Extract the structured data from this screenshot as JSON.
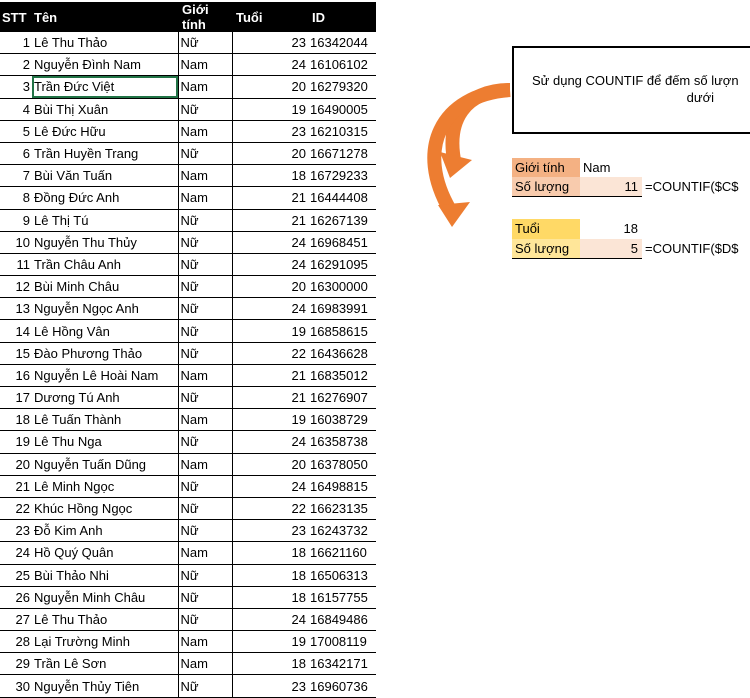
{
  "headers": {
    "stt": "STT",
    "ten": "Tên",
    "gioitinh": "Giới tính",
    "tuoi": "Tuổi",
    "id": "ID"
  },
  "rows": [
    {
      "stt": "1",
      "ten": "Lê Thu Thảo",
      "gt": "Nữ",
      "tuoi": "23",
      "id": "16342044"
    },
    {
      "stt": "2",
      "ten": "Nguyễn Đình Nam",
      "gt": "Nam",
      "tuoi": "24",
      "id": "16106102"
    },
    {
      "stt": "3",
      "ten": "Trần Đức Việt",
      "gt": "Nam",
      "tuoi": "20",
      "id": "16279320"
    },
    {
      "stt": "4",
      "ten": "Bùi Thị Xuân",
      "gt": "Nữ",
      "tuoi": "19",
      "id": "16490005"
    },
    {
      "stt": "5",
      "ten": "Lê Đức Hữu",
      "gt": "Nam",
      "tuoi": "23",
      "id": "16210315"
    },
    {
      "stt": "6",
      "ten": "Trần Huyền Trang",
      "gt": "Nữ",
      "tuoi": "20",
      "id": "16671278"
    },
    {
      "stt": "7",
      "ten": "Bùi Văn Tuấn",
      "gt": "Nam",
      "tuoi": "18",
      "id": "16729233"
    },
    {
      "stt": "8",
      "ten": "Đồng Đức Anh",
      "gt": "Nam",
      "tuoi": "21",
      "id": "16444408"
    },
    {
      "stt": "9",
      "ten": "Lê Thị Tú",
      "gt": "Nữ",
      "tuoi": "21",
      "id": "16267139"
    },
    {
      "stt": "10",
      "ten": "Nguyễn Thu Thủy",
      "gt": "Nữ",
      "tuoi": "24",
      "id": "16968451"
    },
    {
      "stt": "11",
      "ten": "Trần Châu Anh",
      "gt": "Nữ",
      "tuoi": "24",
      "id": "16291095"
    },
    {
      "stt": "12",
      "ten": "Bùi Minh Châu",
      "gt": "Nữ",
      "tuoi": "20",
      "id": "16300000"
    },
    {
      "stt": "13",
      "ten": "Nguyễn Ngọc Anh",
      "gt": "Nữ",
      "tuoi": "24",
      "id": "16983991"
    },
    {
      "stt": "14",
      "ten": "Lê Hồng Vân",
      "gt": "Nữ",
      "tuoi": "19",
      "id": "16858615"
    },
    {
      "stt": "15",
      "ten": "Đào Phương Thảo",
      "gt": "Nữ",
      "tuoi": "22",
      "id": "16436628"
    },
    {
      "stt": "16",
      "ten": "Nguyễn Lê Hoài Nam",
      "gt": "Nam",
      "tuoi": "21",
      "id": "16835012"
    },
    {
      "stt": "17",
      "ten": "Dương Tú Anh",
      "gt": "Nữ",
      "tuoi": "21",
      "id": "16276907"
    },
    {
      "stt": "18",
      "ten": "Lê Tuấn Thành",
      "gt": "Nam",
      "tuoi": "19",
      "id": "16038729"
    },
    {
      "stt": "19",
      "ten": "Lê Thu Nga",
      "gt": "Nữ",
      "tuoi": "24",
      "id": "16358738"
    },
    {
      "stt": "20",
      "ten": "Nguyễn Tuấn Dũng",
      "gt": "Nam",
      "tuoi": "20",
      "id": "16378050"
    },
    {
      "stt": "21",
      "ten": "Lê Minh Ngọc",
      "gt": "Nữ",
      "tuoi": "24",
      "id": "16498815"
    },
    {
      "stt": "22",
      "ten": "Khúc Hồng Ngọc",
      "gt": "Nữ",
      "tuoi": "22",
      "id": "16623135"
    },
    {
      "stt": "23",
      "ten": "Đỗ Kim Anh",
      "gt": "Nữ",
      "tuoi": "23",
      "id": "16243732"
    },
    {
      "stt": "24",
      "ten": "Hồ Quý Quân",
      "gt": "Nam",
      "tuoi": "18",
      "id": "16621160"
    },
    {
      "stt": "25",
      "ten": "Bùi Thảo Nhi",
      "gt": "Nữ",
      "tuoi": "18",
      "id": "16506313"
    },
    {
      "stt": "26",
      "ten": "Nguyễn Minh Châu",
      "gt": "Nữ",
      "tuoi": "18",
      "id": "16157755"
    },
    {
      "stt": "27",
      "ten": "Lê Thu Thảo",
      "gt": "Nữ",
      "tuoi": "24",
      "id": "16849486"
    },
    {
      "stt": "28",
      "ten": "Lại Trường Minh",
      "gt": "Nam",
      "tuoi": "19",
      "id": "17008119"
    },
    {
      "stt": "29",
      "ten": "Trần Lê Sơn",
      "gt": "Nam",
      "tuoi": "18",
      "id": "16342171"
    },
    {
      "stt": "30",
      "ten": "Nguyễn Thủy Tiên",
      "gt": "Nữ",
      "tuoi": "23",
      "id": "16960736"
    }
  ],
  "note": {
    "line1": "Sử dụng COUNTIF để đếm số lượn",
    "line2": "dưới"
  },
  "criteria": {
    "gioitinh_label": "Giới tính",
    "gioitinh_value": "Nam",
    "soluong_label": "Số lượng",
    "soluong1_value": "11",
    "soluong1_formula": "=COUNTIF($C$",
    "tuoi_label": "Tuổi",
    "tuoi_value": "18",
    "soluong2_value": "5",
    "soluong2_formula": "=COUNTIF($D$"
  },
  "colors": {
    "accent_orange": "#ed7d31",
    "selection_green": "#217346"
  }
}
